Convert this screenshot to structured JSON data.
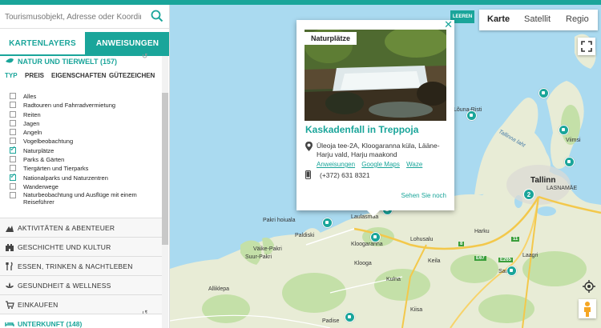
{
  "colors": {
    "accent": "#1aa59a",
    "water": "#aadaf0",
    "land": "#e8ecd6",
    "forest": "#c4e0a8"
  },
  "search": {
    "placeholder": "Tourismusobjekt, Adresse oder Koordinate",
    "icon": "search-icon"
  },
  "tabs": {
    "layers": "KARTENLAYERS",
    "directions": "ANWEISUNGEN"
  },
  "open_category": {
    "label": "NATUR UND TIERWELT (157)",
    "icon": "leaf-icon"
  },
  "subtabs": [
    "TYP",
    "PREIS",
    "EIGENSCHAFTEN",
    "GÜTEZEICHEN"
  ],
  "filters": [
    {
      "label": "Alles",
      "checked": false
    },
    {
      "label": "Radtouren und Fahrradvermietung",
      "checked": false
    },
    {
      "label": "Reiten",
      "checked": false
    },
    {
      "label": "Jagen",
      "checked": false
    },
    {
      "label": "Angeln",
      "checked": false
    },
    {
      "label": "Vogelbeobachtung",
      "checked": false
    },
    {
      "label": "Naturplätze",
      "checked": true
    },
    {
      "label": "Parks & Gärten",
      "checked": false
    },
    {
      "label": "Tiergärten und Tierparks",
      "checked": false
    },
    {
      "label": "Nationalparks und Naturzentren",
      "checked": true
    },
    {
      "label": "Wanderwege",
      "checked": false
    },
    {
      "label": "Naturbeobachtung und Ausflüge mit einem Reiseführer",
      "checked": false
    }
  ],
  "categories": [
    {
      "label": "AKTIVITÄTEN & ABENTEUER",
      "icon": "activity-icon"
    },
    {
      "label": "GESCHICHTE UND KULTUR",
      "icon": "castle-icon"
    },
    {
      "label": "ESSEN, TRINKEN & NACHTLEBEN",
      "icon": "cutlery-icon"
    },
    {
      "label": "GESUNDHEIT & WELLNESS",
      "icon": "lotus-icon"
    },
    {
      "label": "EINKAUFEN",
      "icon": "cart-icon"
    }
  ],
  "bottom_category": {
    "label": "UNTERKUNFT (148)",
    "icon": "bed-icon"
  },
  "map_types": {
    "map": "Karte",
    "satellite": "Satellit",
    "regio": "Regio"
  },
  "leeren": "LEEREN",
  "popup": {
    "tag": "Naturplätze",
    "title": "Kaskadenfall in Treppoja",
    "address": "Üleoja tee-2A, Kloogaranna küla, Lääne-Harju vald, Harju maakond",
    "links": [
      "Anweisungen",
      "Google Maps",
      "Waze"
    ],
    "phone": "(+372) 631 8321",
    "more": "Sehen Sie noch"
  },
  "map_labels": {
    "tallinn": "Tallinn",
    "pakri_hoiuala": "Pakri hoiuala",
    "paldiski": "Paldiski",
    "vaike_pakri": "Väike-Pakri",
    "suur_pakri": "Suur-Pakri",
    "kloogaranna": "Kloogaranna",
    "laulasmaa": "Laulasmaa",
    "klooga": "Klooga",
    "keila": "Keila",
    "kulna": "Kulna",
    "alliklepa": "Alliklepa",
    "lohusalu": "Lohusalu",
    "harku": "Harku",
    "saue": "Saue",
    "kiisa": "Kiisa",
    "padise": "Padise",
    "laagri": "Laagri",
    "louna_risti": "Lõuna-Risti",
    "tallinna_laht": "Tallinna laht",
    "viimsi": "Viimsi",
    "lasnamae": "LASNAMÄE",
    "cluster_count": "2",
    "road_e67": "E67",
    "road_e265": "E265",
    "road_11": "11",
    "road_8": "8"
  }
}
